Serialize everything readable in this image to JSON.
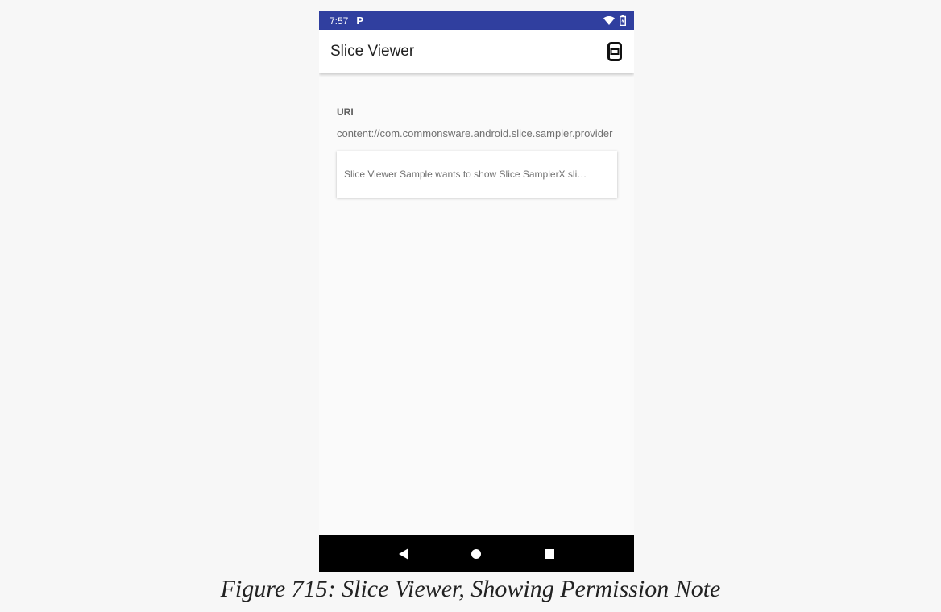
{
  "status_bar": {
    "time": "7:57",
    "notification_glyph": "P",
    "icons": [
      "wifi-icon",
      "battery-charging-icon"
    ],
    "color": "#303f9f"
  },
  "app_bar": {
    "title": "Slice Viewer",
    "action_icon": "phone-frame-icon"
  },
  "content": {
    "uri_label": "URI",
    "uri_value": "content://com.commonsware.android.slice.sampler.provider",
    "slice_message": "Slice Viewer Sample wants to show Slice SamplerX sli…"
  },
  "nav_bar": {
    "buttons": [
      "back-icon",
      "home-icon",
      "recents-icon"
    ]
  },
  "caption": "Figure 715: Slice Viewer, Showing Permission Note"
}
